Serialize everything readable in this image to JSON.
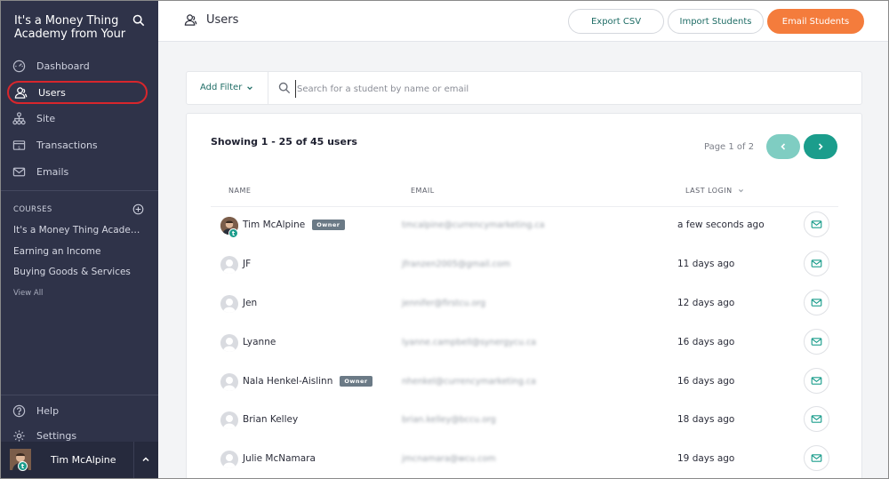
{
  "sidebar": {
    "brand": "It's a Money Thing Academy from Your",
    "nav": [
      {
        "label": "Dashboard",
        "icon": "gauge-icon"
      },
      {
        "label": "Users",
        "icon": "users-icon",
        "active": true
      },
      {
        "label": "Site",
        "icon": "sitemap-icon"
      },
      {
        "label": "Transactions",
        "icon": "receipt-icon"
      },
      {
        "label": "Emails",
        "icon": "envelope-icon"
      }
    ],
    "courses_heading": "COURSES",
    "courses": [
      "It's a Money Thing Academy from Your Credit Union",
      "Earning an Income",
      "Buying Goods & Services"
    ],
    "view_all": "View All",
    "help": "Help",
    "settings": "Settings",
    "user_name": "Tim McAlpine",
    "user_badge": "t"
  },
  "topbar": {
    "title": "Users",
    "export_csv": "Export CSV",
    "import_students": "Import Students",
    "email_students": "Email Students"
  },
  "filter": {
    "add_filter": "Add Filter",
    "search_placeholder": "Search for a student by name or email"
  },
  "panel": {
    "showing": "Showing 1 - 25 of 45 users",
    "page_of": "Page 1 of 2",
    "columns": {
      "name": "NAME",
      "email": "EMAIL",
      "last_login": "LAST LOGIN"
    },
    "owner_label": "Owner",
    "rows": [
      {
        "name": "Tim McAlpine",
        "email": "tmcalpine@currencymarketing.ca",
        "last_login": "a few seconds ago",
        "owner": true,
        "photo": true
      },
      {
        "name": "JF",
        "email": "jfranzen2005@gmail.com",
        "last_login": "11 days ago",
        "owner": false
      },
      {
        "name": "Jen",
        "email": "jennifer@firstcu.org",
        "last_login": "12 days ago",
        "owner": false
      },
      {
        "name": "Lyanne",
        "email": "lyanne.campbell@synergycu.ca",
        "last_login": "16 days ago",
        "owner": false
      },
      {
        "name": "Nala Henkel-Aislinn",
        "email": "nhenkel@currencymarketing.ca",
        "last_login": "16 days ago",
        "owner": true
      },
      {
        "name": "Brian Kelley",
        "email": "brian.kelley@bccu.org",
        "last_login": "18 days ago",
        "owner": false
      },
      {
        "name": "Julie McNamara",
        "email": "jmcnamara@wcu.com",
        "last_login": "19 days ago",
        "owner": false
      }
    ]
  },
  "colors": {
    "sidebar_bg": "#2f3349",
    "accent_teal": "#1b9d8c",
    "accent_orange": "#f47c3c",
    "highlight_red": "#d8262c"
  }
}
